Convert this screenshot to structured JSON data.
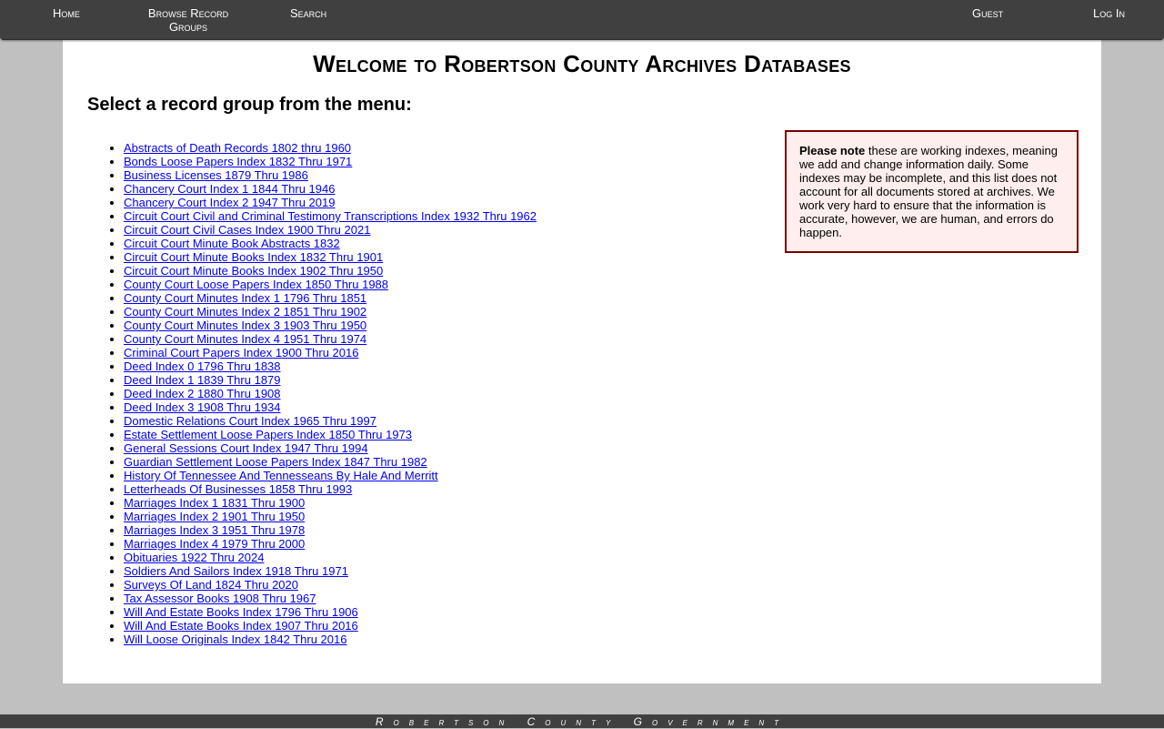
{
  "nav": {
    "home": "Home",
    "browse": "Browse Record Groups",
    "search": "Search",
    "guest": "Guest",
    "login": "Log In"
  },
  "page": {
    "title": "Welcome to Robertson County Archives Databases",
    "subtitle": "Select a record group from the menu:"
  },
  "record_groups": [
    "Abstracts of Death Records 1802 thru 1960",
    "Bonds Loose Papers Index 1832 Thru 1971",
    "Business Licenses 1879 Thru 1986",
    "Chancery Court Index 1 1844 Thru 1946",
    "Chancery Court Index 2 1947 Thru 2019",
    "Circuit Court Civil and Criminal Testimony Transcriptions Index 1932 Thru 1962",
    "Circuit Court Civil Cases Index 1900 Thru 2021",
    "Circuit Court Minute Book Abstracts 1832",
    "Circuit Court Minute Books Index 1832 Thru 1901",
    "Circuit Court Minute Books Index 1902 Thru 1950",
    "County Court Loose Papers Index 1850 Thru 1988",
    "County Court Minutes Index 1 1796 Thru 1851",
    "County Court Minutes Index 2 1851 Thru 1902",
    "County Court Minutes Index 3 1903 Thru 1950",
    "County Court Minutes Index 4 1951 Thru 1974",
    "Criminal Court Papers Index 1900 Thru 2016",
    "Deed Index 0 1796 Thru 1838",
    "Deed Index 1 1839 Thru 1879",
    "Deed Index 2 1880 Thru 1908",
    "Deed Index 3 1908 Thru 1934",
    "Domestic Relations Court Index 1965 Thru 1997",
    "Estate Settlement Loose Papers Index 1850 Thru 1973",
    "General Sessions Court Index 1947 Thru 1994",
    "Guardian Settlement Loose Papers Index 1847 Thru 1982",
    "History Of Tennessee And Tennesseans By Hale And Merritt",
    "Letterheads Of Businesses 1858 Thru 1993",
    "Marriages Index 1 1831 Thru 1900",
    "Marriages Index 2 1901 Thru 1950",
    "Marriages Index 3 1951 Thru 1978",
    "Marriages Index 4 1979 Thru 2000",
    "Obituaries 1922 Thru 2024",
    "Soldiers And Sailors Index 1918 Thru 1971",
    "Surveys Of Land 1824 Thru 2020",
    "Tax Assessor Books 1908 Thru 1967",
    "Will And Estate Books Index 1796 Thru 1906",
    "Will And Estate Books Index 1907 Thru 2016",
    "Will Loose Originals Index 1842 Thru 2016"
  ],
  "note": {
    "bold": "Please note",
    "text": " these are working indexes, meaning we add and change information daily. Some indexes may be incomplete, and this list does not account for all documents stored at archives. We work very hard to ensure that the information is accurate, however, we are human, and errors do happen."
  },
  "footer": {
    "text": "Robertson County Government"
  },
  "colors": {
    "nav_bg": "#404040",
    "page_bg": "#c0c0c0",
    "link": "#0000ee",
    "note_bg": "#ffeeee",
    "note_border": "#7a0000"
  }
}
